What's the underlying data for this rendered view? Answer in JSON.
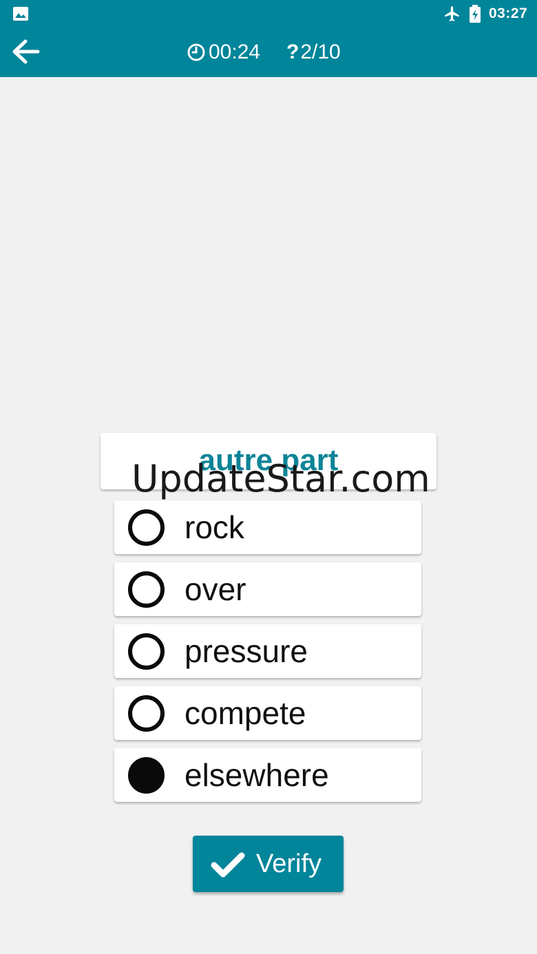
{
  "status_bar": {
    "time": "03:27",
    "icons": [
      "image-icon",
      "airplane-icon",
      "battery-charging-icon"
    ]
  },
  "app_bar": {
    "back_icon": "arrow-left-icon",
    "timer_icon": "clock-icon",
    "timer": "00:24",
    "question_icon": "question-mark-icon",
    "question_progress": "2/10"
  },
  "quiz": {
    "word": "autre part",
    "options": [
      {
        "label": "rock",
        "selected": false
      },
      {
        "label": "over",
        "selected": false
      },
      {
        "label": "pressure",
        "selected": false
      },
      {
        "label": "compete",
        "selected": false
      },
      {
        "label": "elsewhere",
        "selected": true
      }
    ],
    "verify_label": "Verify",
    "verify_icon": "checkmark-icon"
  },
  "watermark": "UpdateStar.com",
  "colors": {
    "primary": "#00859a",
    "word_text": "#0e8497",
    "background": "#f1f1f1"
  }
}
